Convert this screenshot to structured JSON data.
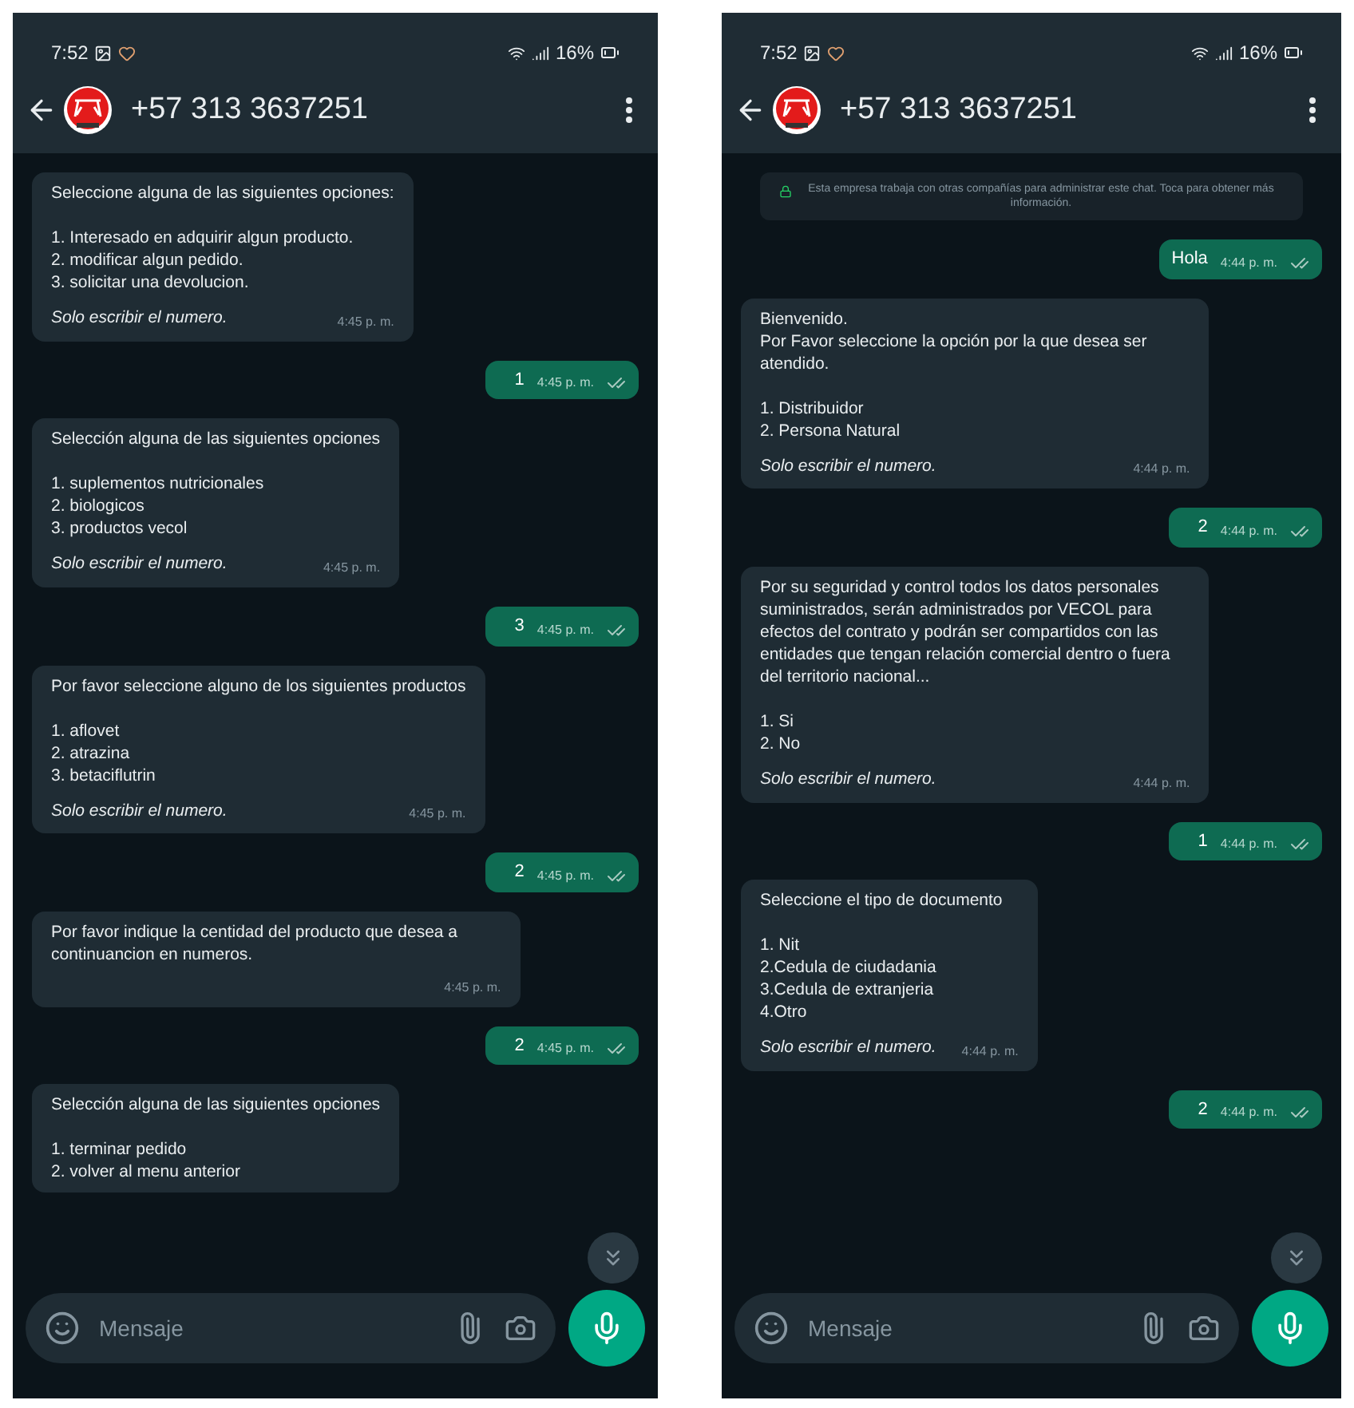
{
  "phones": [
    {
      "status_bar": {
        "time": "7:52",
        "battery": "16%"
      },
      "contact": {
        "name": "+57 313 3637251"
      },
      "messages": [
        {
          "kind": "in",
          "text": "Seleccione alguna de las siguientes opciones:\n\n1. Interesado en adquirir algun producto.\n2. modificar algun pedido.\n3. solicitar una devolucion.",
          "footer": "Solo escribir el numero.",
          "time": "4:45 p. m."
        },
        {
          "kind": "out",
          "text": "1",
          "time": "4:45 p. m."
        },
        {
          "kind": "in",
          "text": "Selección alguna de las siguientes opciones\n\n1. suplementos nutricionales\n2. biologicos\n3. productos vecol",
          "footer": "Solo escribir el numero.",
          "time": "4:45 p. m."
        },
        {
          "kind": "out",
          "text": "3",
          "time": "4:45 p. m."
        },
        {
          "kind": "in",
          "text": "Por favor seleccione alguno de los siguientes productos\n\n1. aflovet\n2. atrazina\n3. betaciflutrin",
          "footer": "Solo escribir el numero.",
          "time": "4:45 p. m."
        },
        {
          "kind": "out",
          "text": "2",
          "time": "4:45 p. m."
        },
        {
          "kind": "in",
          "text": "Por favor indique la centidad del producto que desea a continuancion en numeros.",
          "time": "4:45 p. m."
        },
        {
          "kind": "out",
          "text": "2",
          "time": "4:45 p. m."
        },
        {
          "kind": "in",
          "text": "Selección alguna de las siguientes opciones\n\n1. terminar pedido\n2. volver al menu anterior"
        }
      ],
      "composer": {
        "placeholder": "Mensaje"
      }
    },
    {
      "status_bar": {
        "time": "7:52",
        "battery": "16%"
      },
      "contact": {
        "name": "+57 313 3637251"
      },
      "notice": "Esta empresa trabaja con otras compañías para administrar este chat. Toca para obtener más información.",
      "messages": [
        {
          "kind": "out",
          "text": "Hola",
          "time": "4:44 p. m."
        },
        {
          "kind": "in",
          "text": "Bienvenido.\nPor Favor seleccione la opción por la que desea ser atendido.\n\n1. Distribuidor\n2. Persona Natural",
          "footer": "Solo escribir el numero.",
          "time": "4:44 p. m."
        },
        {
          "kind": "out",
          "text": "2",
          "time": "4:44 p. m."
        },
        {
          "kind": "in",
          "text": "Por su seguridad y control todos los datos personales suministrados, serán administrados por VECOL para efectos del contrato y podrán ser compartidos con las entidades que tengan relación comercial dentro o fuera del territorio nacional...\n\n1. Si\n2. No",
          "footer": "Solo escribir el numero.",
          "time": "4:44 p. m."
        },
        {
          "kind": "out",
          "text": "1",
          "time": "4:44 p. m."
        },
        {
          "kind": "in",
          "text": "Seleccione  el tipo de documento\n\n1. Nit\n2.Cedula de ciudadania\n3.Cedula de extranjeria\n4.Otro",
          "footer": "Solo escribir el numero.",
          "time": "4:44 p. m."
        },
        {
          "kind": "out",
          "text": "2",
          "time": "4:44 p. m."
        }
      ],
      "composer": {
        "placeholder": "Mensaje"
      }
    }
  ]
}
